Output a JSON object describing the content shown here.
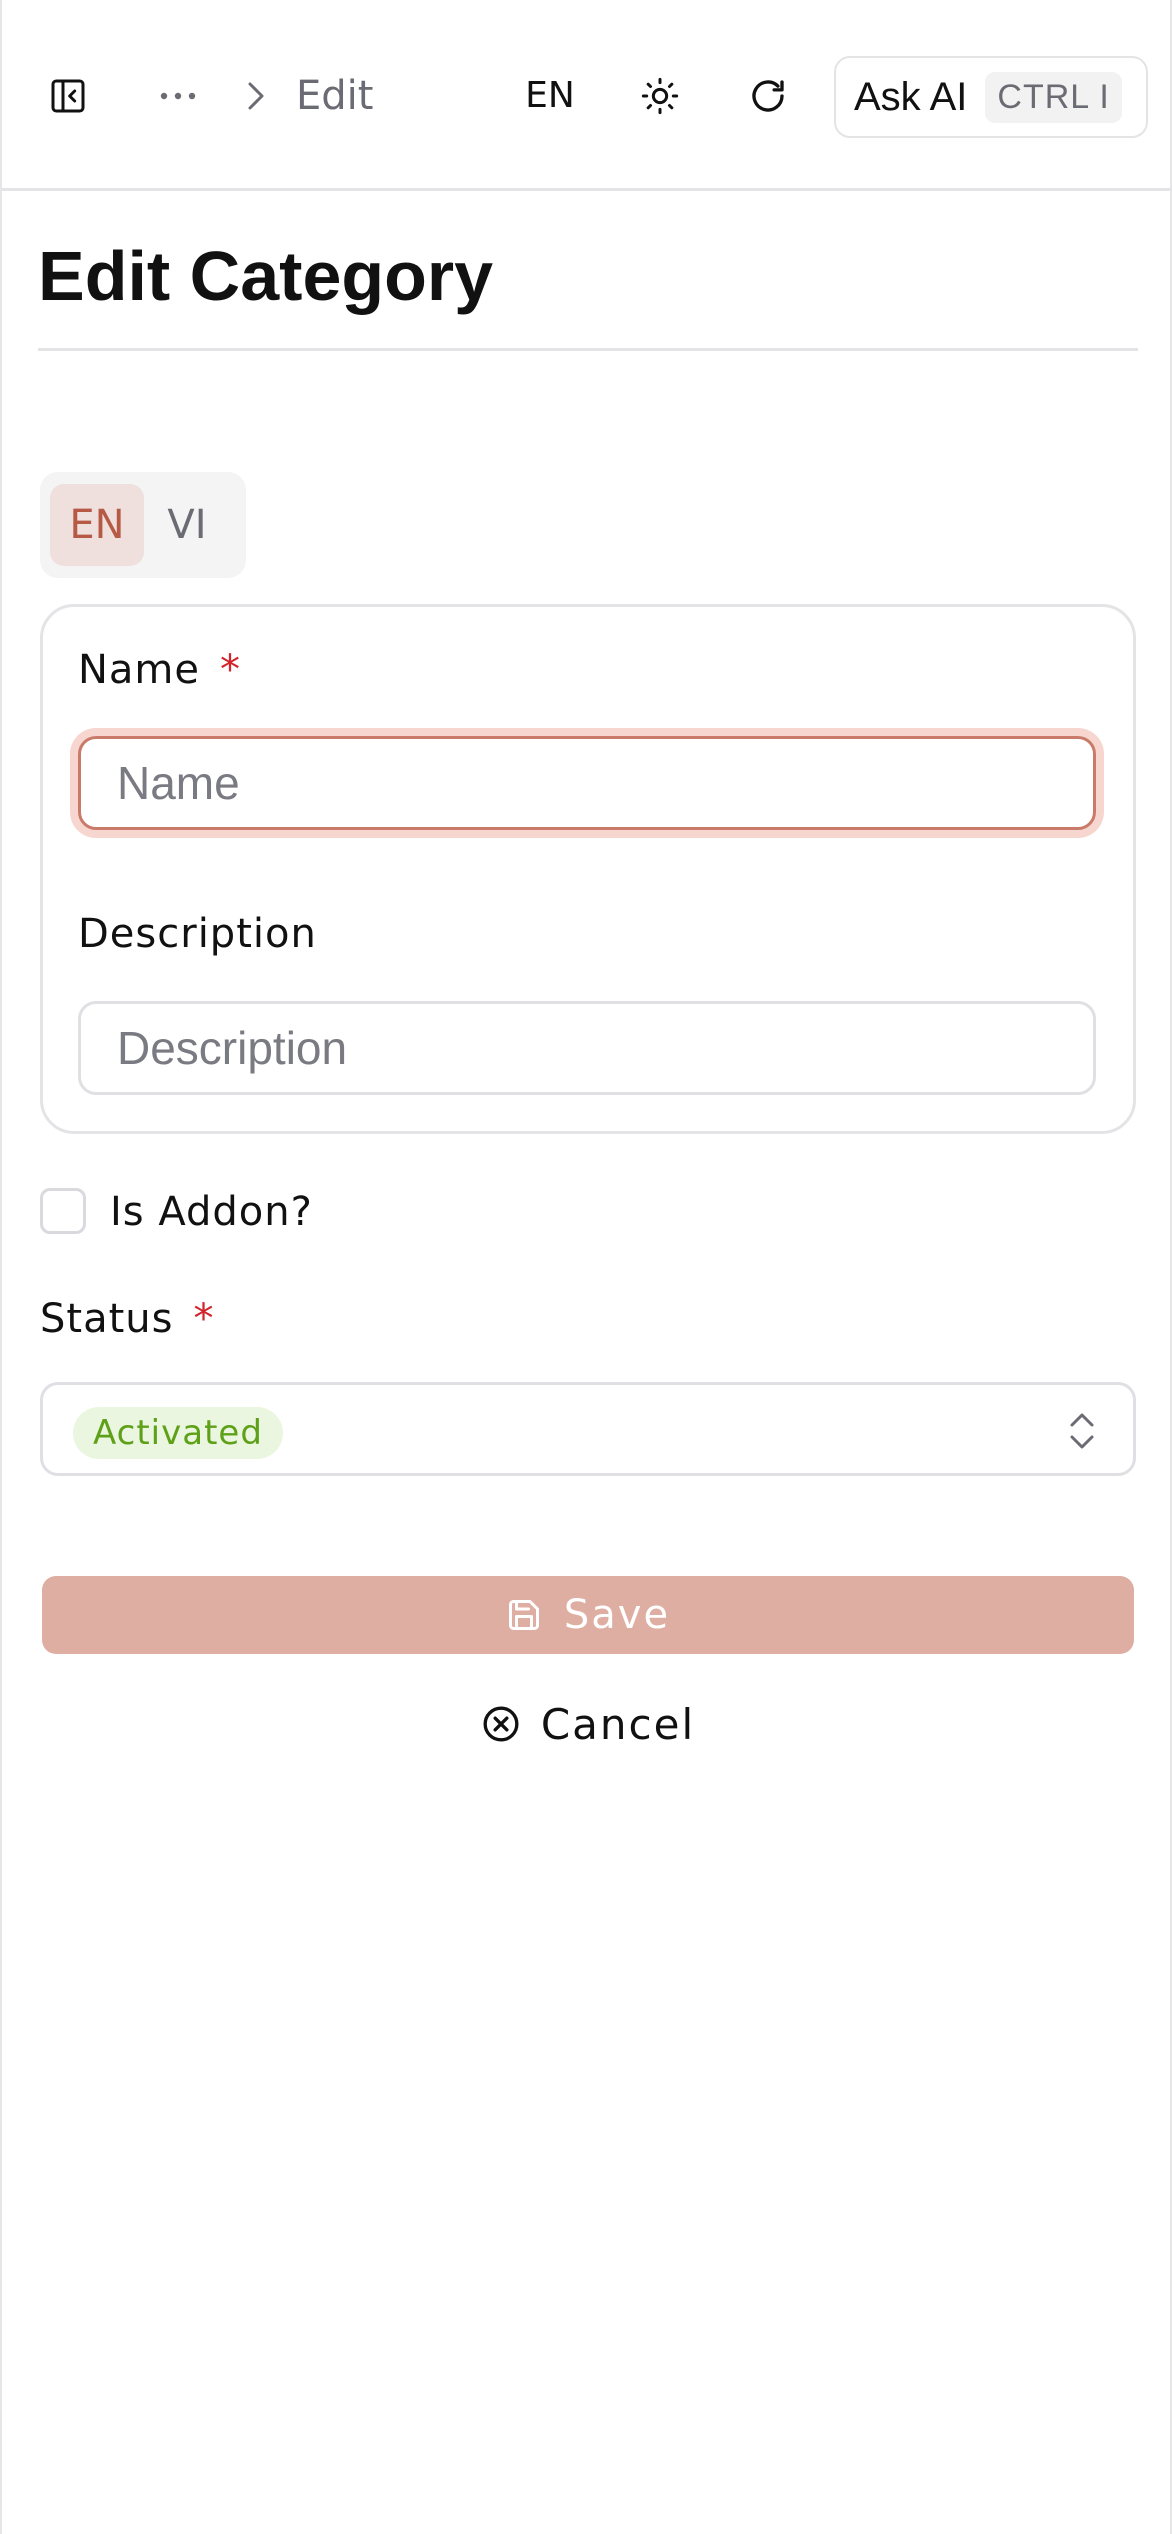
{
  "header": {
    "breadcrumb_current": "Edit",
    "language": "EN",
    "ask_ai_label": "Ask AI",
    "ask_ai_shortcut": "CTRL I"
  },
  "page": {
    "title": "Edit Category"
  },
  "language_tabs": [
    {
      "label": "EN",
      "active": true
    },
    {
      "label": "VI",
      "active": false
    }
  ],
  "form": {
    "name": {
      "label": "Name",
      "required_mark": "*",
      "placeholder": "Name",
      "value": ""
    },
    "description": {
      "label": "Description",
      "placeholder": "Description",
      "value": ""
    },
    "is_addon": {
      "label": "Is Addon?",
      "checked": false
    },
    "status": {
      "label": "Status",
      "required_mark": "*",
      "value": "Activated",
      "value_color": "#5ea119"
    }
  },
  "actions": {
    "save_label": "Save",
    "cancel_label": "Cancel"
  },
  "colors": {
    "accent": "#b65a45",
    "save_button": "#dfaea3",
    "required": "#d2242c"
  }
}
